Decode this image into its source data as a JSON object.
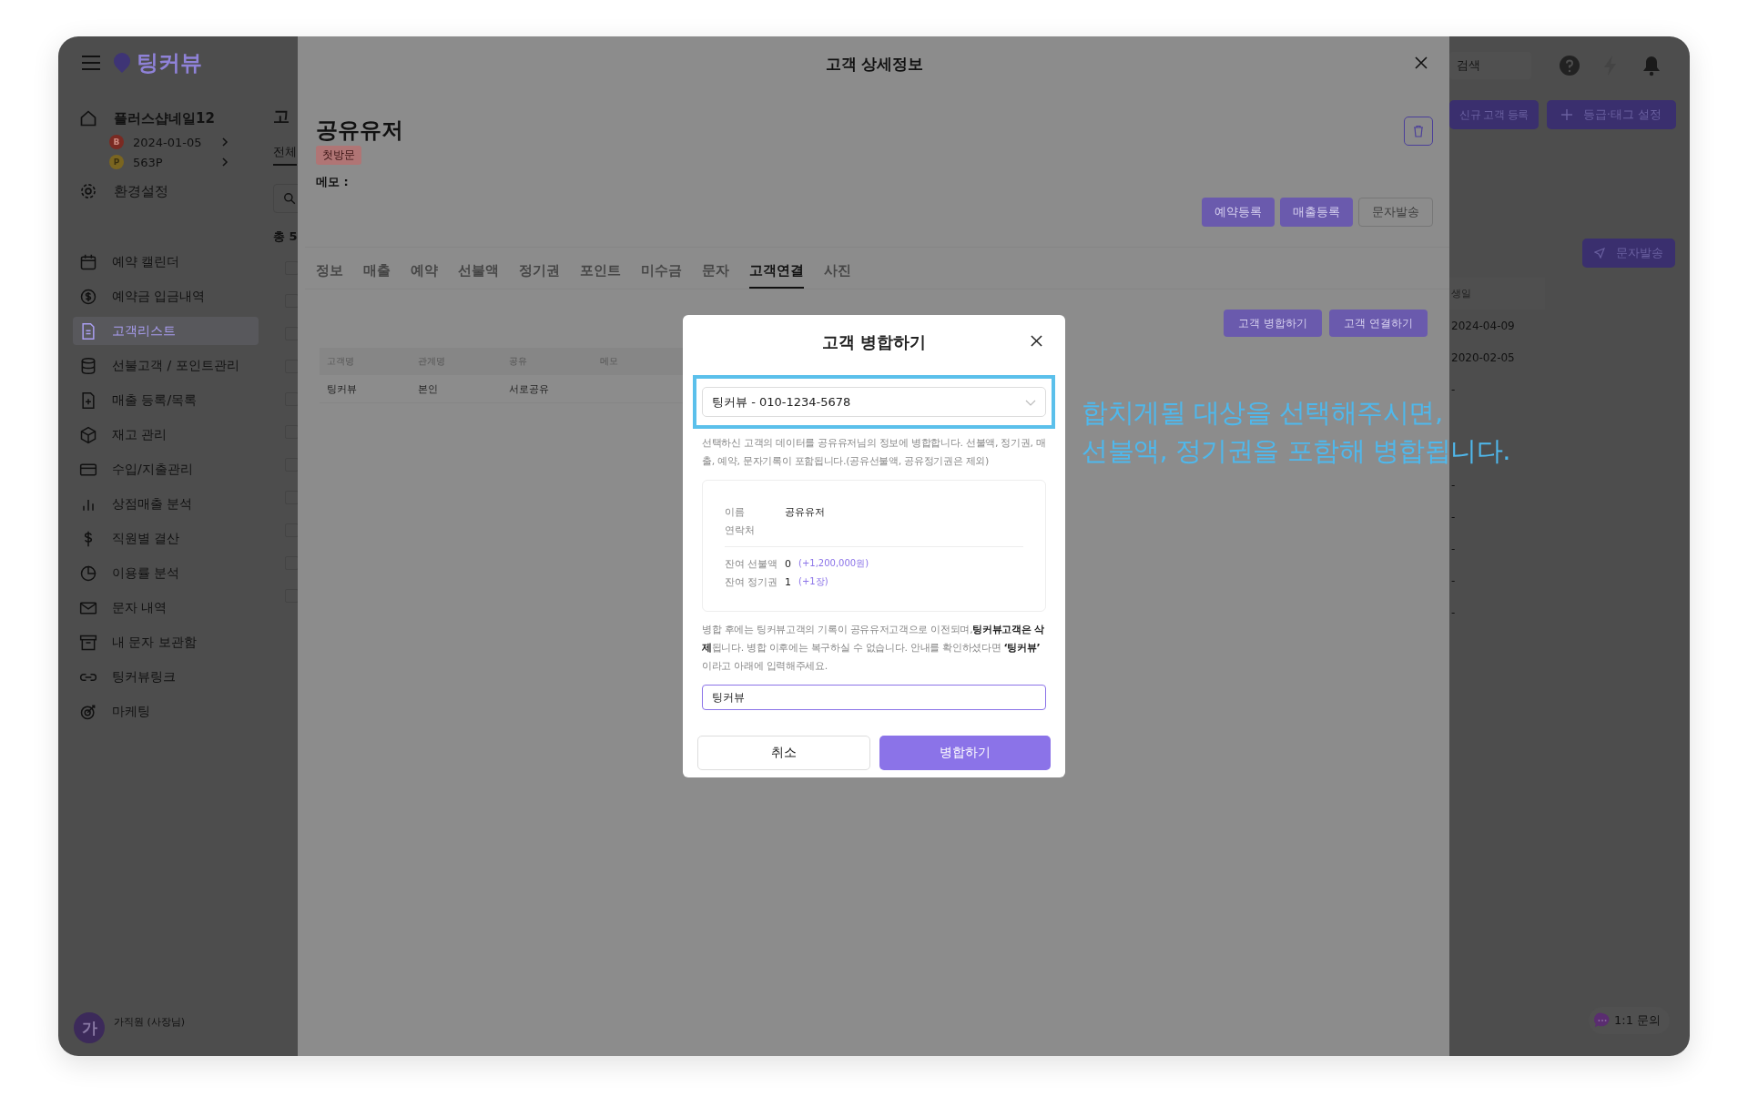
{
  "sidebar": {
    "brand": "팅커뷰",
    "store_name": "플러스샵네일12",
    "store_meta": [
      {
        "kind": "grade",
        "badge": "B",
        "text": "2024-01-05"
      },
      {
        "kind": "point",
        "badge": "P",
        "text": "563P"
      }
    ],
    "settings": "환경설정",
    "menu": [
      {
        "label": "예약 캘린더",
        "selected": false
      },
      {
        "label": "예약금 입금내역",
        "selected": false
      },
      {
        "label": "고객리스트",
        "selected": true
      },
      {
        "label": "선불고객 / 포인트관리",
        "selected": false
      },
      {
        "label": "매출 등록/목록",
        "selected": false
      },
      {
        "label": "재고 관리",
        "selected": false
      },
      {
        "label": "수입/지출관리",
        "selected": false
      },
      {
        "label": "상점매출 분석",
        "selected": false
      },
      {
        "label": "직원별 결산",
        "selected": false
      },
      {
        "label": "이용률 분석",
        "selected": false
      },
      {
        "label": "문자 내역",
        "selected": false
      },
      {
        "label": "내 문자 보관함",
        "selected": false
      },
      {
        "label": "팅커뷰링크",
        "selected": false
      },
      {
        "label": "마케팅",
        "selected": false
      }
    ],
    "user": {
      "avatar": "가",
      "name": "가직원 (사장님)"
    }
  },
  "background": {
    "left": {
      "title": "고",
      "tab": "전체",
      "count": "총 5",
      "row_checkboxes": [
        {
          "checked": false
        },
        {
          "checked": false
        },
        {
          "checked": false
        },
        {
          "checked": false
        },
        {
          "checked": false
        },
        {
          "checked": false
        },
        {
          "checked": false
        },
        {
          "checked": false
        },
        {
          "checked": false
        },
        {
          "checked": false
        },
        {
          "checked": false
        }
      ]
    },
    "right": {
      "search_placeholder": "검색",
      "buttons": [
        "신규 고객 등록",
        "등급·태그 설정"
      ],
      "sms_button": "문자발송",
      "column": "생일",
      "rows_top": [
        "2024-04-09",
        "2020-02-05",
        "-"
      ],
      "rows_bottom": [
        "-",
        "-",
        "-",
        "-",
        "-"
      ],
      "chat": "1:1 문의"
    }
  },
  "detail": {
    "title": "고객 상세정보",
    "name": "공유유저",
    "tag": "첫방문",
    "memo_label": "메모 :",
    "actions": [
      {
        "label": "예약등록",
        "disabled": false
      },
      {
        "label": "매출등록",
        "disabled": false
      },
      {
        "label": "문자발송",
        "disabled": true
      }
    ],
    "tabs": [
      {
        "label": "정보",
        "selected": false
      },
      {
        "label": "매출",
        "selected": false
      },
      {
        "label": "예약",
        "selected": false
      },
      {
        "label": "선불액",
        "selected": false
      },
      {
        "label": "정기권",
        "selected": false
      },
      {
        "label": "포인트",
        "selected": false
      },
      {
        "label": "미수금",
        "selected": false
      },
      {
        "label": "문자",
        "selected": false
      },
      {
        "label": "고객연결",
        "selected": true
      },
      {
        "label": "사진",
        "selected": false
      }
    ],
    "link_buttons": [
      "고객 병합하기",
      "고객 연결하기"
    ],
    "table": {
      "columns": [
        "고객명",
        "관계명",
        "공유",
        "메모"
      ],
      "rows": [
        [
          "팅커뷰",
          "본인",
          "서로공유"
        ]
      ]
    }
  },
  "merge_dialog": {
    "title": "고객 병합하기",
    "select_value": "팅커뷰 - 010-1234-5678",
    "description": "선택하신 고객의 데이터를 공유유저님의 정보에 병합합니다. 선불액, 정기권, 매출, 예약, 문자기록이 포함됩니다.(공유선불액, 공유정기권은 제외)",
    "fields": [
      {
        "label": "이름",
        "value": "공유유저"
      },
      {
        "label": "연락처"
      }
    ],
    "balances": [
      {
        "label": "잔여 선불액",
        "value": "0",
        "delta": "(+1,200,000원)"
      },
      {
        "label": "잔여 정기권",
        "value": "1",
        "delta": "(+1장)"
      }
    ],
    "warning": "병합 후에는 팅커뷰고객의 기록이 공유유저고객으로 이전되며,**팅커뷰고객은 삭제**됩니다. 병합 이후에는 복구하실 수 없습니다. 안내를 확인하셨다면 **‘팅커뷰’** 이라고 아래에 입력해주세요.",
    "input_value": "팅커뷰",
    "buttons": [
      {
        "label": "취소",
        "kind": "secondary"
      },
      {
        "label": "병합하기",
        "kind": "primary"
      }
    ]
  },
  "annotation": {
    "text": "합치게될 대상을 선택해주시면,\n선불액, 정기권을 포함해 병합됩니다."
  }
}
